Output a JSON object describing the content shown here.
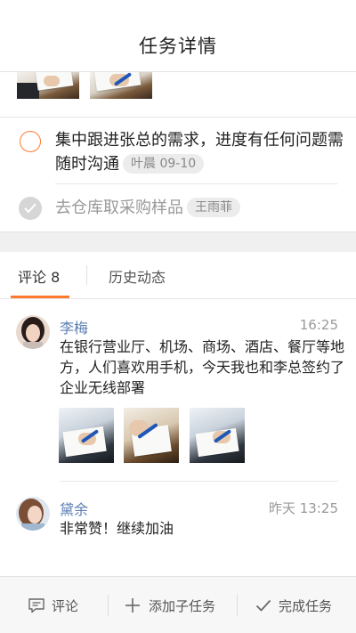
{
  "header": {
    "title": "任务详情"
  },
  "tasks": [
    {
      "text": "集中跟进张总的需求，进度有任何问题需随时沟通",
      "tag": "叶晨 09-10",
      "done": false
    },
    {
      "text": "去仓库取采购样品",
      "tag": "王雨菲",
      "done": true
    }
  ],
  "tabs": {
    "comments_label": "评论 8",
    "history_label": "历史动态"
  },
  "comments": [
    {
      "name": "李梅",
      "time": "16:25",
      "text": "在银行营业厅、机场、商场、酒店、餐厅等地方，人们喜欢用手机，今天我也和李总签约了企业无线部署"
    },
    {
      "name": "黛余",
      "time": "昨天 13:25",
      "text": "非常赞！继续加油"
    }
  ],
  "bottom_bar": {
    "comment_label": "评论",
    "add_subtask_label": "添加子任务",
    "complete_label": "完成任务"
  },
  "colors": {
    "accent": "#ff7a2f",
    "name": "#5b7fb4",
    "tag_bg": "#ececec"
  }
}
